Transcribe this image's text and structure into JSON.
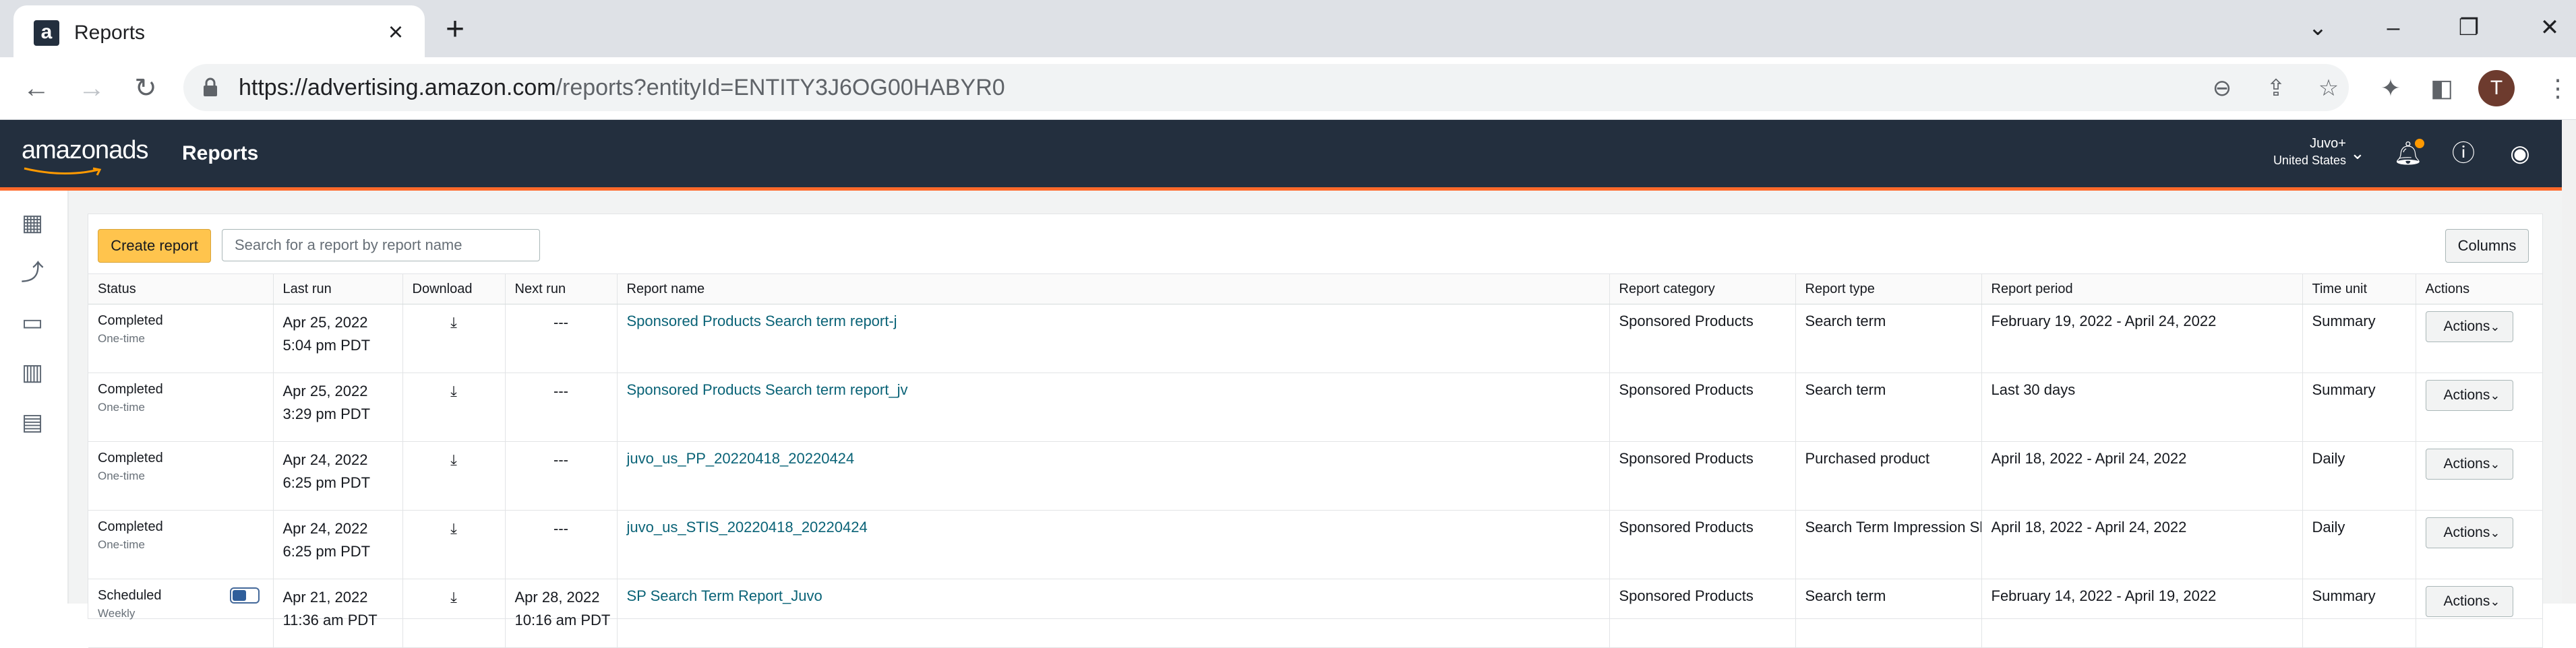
{
  "browser": {
    "tab_title": "Reports",
    "tab_close_icon": "×",
    "new_tab_icon": "+",
    "url_host": "https://advertising.amazon.com",
    "url_path": "/reports?entityId=ENTITY3J6OG00HABYR0",
    "profile_initial": "T"
  },
  "app": {
    "logo_text": "amazonads",
    "header_title": "Reports",
    "account_name": "Juvo+",
    "account_country": "United States",
    "accent_color": "#ff6a2b",
    "header_bg": "#232f3e"
  },
  "toolbar": {
    "create_label": "Create report",
    "search_placeholder": "Search for a report by report name",
    "columns_label": "Columns"
  },
  "table": {
    "headers": {
      "status": "Status",
      "last_run": "Last run",
      "download": "Download",
      "next_run": "Next run",
      "report_name": "Report name",
      "report_category": "Report category",
      "report_type": "Report type",
      "report_period": "Report period",
      "time_unit": "Time unit",
      "actions": "Actions"
    },
    "rows": [
      {
        "status": "Completed",
        "frequency": "One-time",
        "last_run_date": "Apr 25, 2022",
        "last_run_time": "5:04 pm PDT",
        "next_run": "---",
        "name": "Sponsored Products Search term report-j",
        "category": "Sponsored Products",
        "type": "Search term",
        "period": "February 19, 2022 - April 24, 2022",
        "time_unit": "Summary",
        "actions_label": "Actions"
      },
      {
        "status": "Completed",
        "frequency": "One-time",
        "last_run_date": "Apr 25, 2022",
        "last_run_time": "3:29 pm PDT",
        "next_run": "---",
        "name": "Sponsored Products Search term report_jv",
        "category": "Sponsored Products",
        "type": "Search term",
        "period": "Last 30 days",
        "time_unit": "Summary",
        "actions_label": "Actions"
      },
      {
        "status": "Completed",
        "frequency": "One-time",
        "last_run_date": "Apr 24, 2022",
        "last_run_time": "6:25 pm PDT",
        "next_run": "---",
        "name": "juvo_us_PP_20220418_20220424",
        "category": "Sponsored Products",
        "type": "Purchased product",
        "period": "April 18, 2022 - April 24, 2022",
        "time_unit": "Daily",
        "actions_label": "Actions"
      },
      {
        "status": "Completed",
        "frequency": "One-time",
        "last_run_date": "Apr 24, 2022",
        "last_run_time": "6:25 pm PDT",
        "next_run": "---",
        "name": "juvo_us_STIS_20220418_20220424",
        "category": "Sponsored Products",
        "type": "Search Term Impression Sh",
        "period": "April 18, 2022 - April 24, 2022",
        "time_unit": "Daily",
        "actions_label": "Actions"
      },
      {
        "status": "Scheduled",
        "frequency": "Weekly",
        "last_run_date": "Apr 21, 2022",
        "last_run_time": "11:36 am PDT",
        "next_run_date": "Apr 28, 2022",
        "next_run_time": "10:16 am PDT",
        "name": "SP Search Term Report_Juvo",
        "category": "Sponsored Products",
        "type": "Search term",
        "period": "February 14, 2022 - April 19, 2022",
        "time_unit": "Summary",
        "actions_label": "Actions",
        "schedule_enabled": true
      }
    ]
  }
}
